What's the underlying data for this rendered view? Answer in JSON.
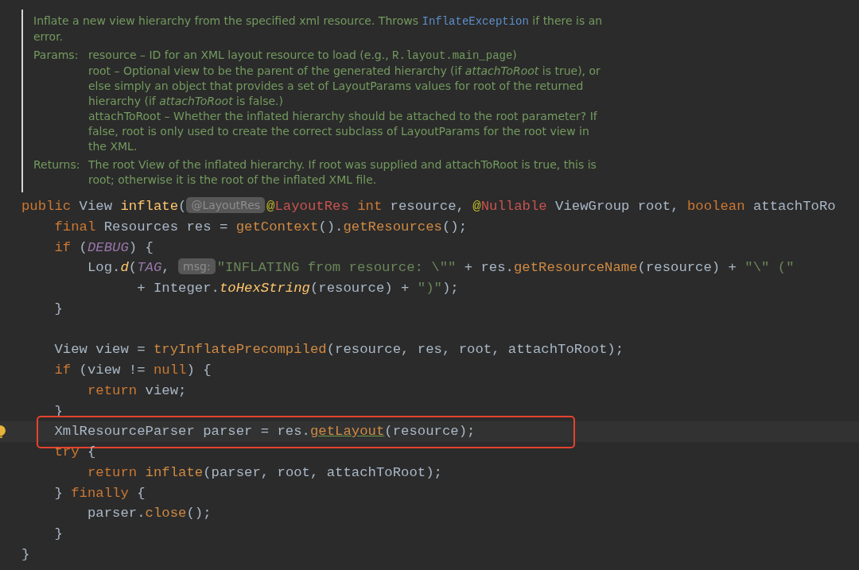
{
  "doc": {
    "description": [
      {
        "kind": "text",
        "text": "Inflate a new view hierarchy from the specified xml resource. Throws "
      },
      {
        "kind": "link",
        "text": "InflateException"
      },
      {
        "kind": "text",
        "text": " if there is an error."
      }
    ],
    "params_label": "Params:",
    "params": [
      [
        {
          "kind": "text",
          "text": "resource – ID for an XML layout resource to load (e.g., "
        },
        {
          "kind": "code",
          "text": "R.layout.main_page"
        },
        {
          "kind": "text",
          "text": ")"
        }
      ],
      [
        {
          "kind": "text",
          "text": "root – Optional view to be the parent of the generated hierarchy (if *attachToRoot* is true), or else simply an object that provides a set of LayoutParams values for root of the returned hierarchy (if *attachToRoot* is false.)"
        }
      ],
      [
        {
          "kind": "text",
          "text": "attachToRoot – Whether the inflated hierarchy should be attached to the root parameter? If false, root is only used to create the correct subclass of LayoutParams for the root view in the XML."
        }
      ]
    ],
    "returns_label": "Returns:",
    "returns": [
      {
        "kind": "text",
        "text": "The root View of the inflated hierarchy. If root was supplied and attachToRoot is true, this is root; otherwise it is the root of the inflated XML file."
      }
    ]
  },
  "code_lines": [
    {
      "kind": "code",
      "highlighted": false,
      "segments": [
        {
          "kind": "code",
          "tokens": [
            {
              "kind": "keyword",
              "text": "public"
            },
            {
              "kind": "plain",
              "text": " View "
            },
            {
              "kind": "decl",
              "text": "inflate"
            },
            {
              "kind": "plain",
              "text": "("
            }
          ]
        },
        {
          "kind": "hint",
          "text": "@LayoutRes"
        },
        {
          "kind": "code",
          "tokens": [
            {
              "kind": "at",
              "text": "@"
            },
            {
              "kind": "annotation",
              "text": "LayoutRes"
            },
            {
              "kind": "keyword",
              "text": " int"
            },
            {
              "kind": "plain",
              "text": " resource, "
            },
            {
              "kind": "at",
              "text": "@"
            },
            {
              "kind": "annotation",
              "text": "Nullable"
            },
            {
              "kind": "plain",
              "text": " ViewGroup root, "
            },
            {
              "kind": "keyword",
              "text": "boolean"
            },
            {
              "kind": "plain",
              "text": " attachToRo"
            }
          ]
        }
      ]
    },
    {
      "kind": "code",
      "highlighted": false,
      "segments": [
        {
          "kind": "code",
          "tokens": [
            {
              "kind": "keyword",
              "text": "    final"
            },
            {
              "kind": "plain",
              "text": " Resources res = "
            },
            {
              "kind": "call",
              "text": "getContext"
            },
            {
              "kind": "plain",
              "text": "()."
            },
            {
              "kind": "call",
              "text": "getResources"
            },
            {
              "kind": "plain",
              "text": "();"
            }
          ]
        }
      ]
    },
    {
      "kind": "code",
      "highlighted": false,
      "segments": [
        {
          "kind": "code",
          "tokens": [
            {
              "kind": "keyword",
              "text": "    if"
            },
            {
              "kind": "plain",
              "text": " ("
            },
            {
              "kind": "constant",
              "text": "DEBUG"
            },
            {
              "kind": "plain",
              "text": ") {"
            }
          ]
        }
      ]
    },
    {
      "kind": "code",
      "highlighted": false,
      "segments": [
        {
          "kind": "code",
          "tokens": [
            {
              "kind": "plain",
              "text": "        Log."
            },
            {
              "kind": "static",
              "text": "d"
            },
            {
              "kind": "plain",
              "text": "("
            },
            {
              "kind": "constant",
              "text": "TAG"
            },
            {
              "kind": "plain",
              "text": ", "
            }
          ]
        },
        {
          "kind": "hint",
          "text": "msg:"
        },
        {
          "kind": "code",
          "tokens": [
            {
              "kind": "string",
              "text": "\"INFLATING from resource: \\\"\""
            },
            {
              "kind": "plain",
              "text": " + res."
            },
            {
              "kind": "call",
              "text": "getResourceName"
            },
            {
              "kind": "plain",
              "text": "(resource) + "
            },
            {
              "kind": "string",
              "text": "\"\\\" (\""
            }
          ]
        }
      ]
    },
    {
      "kind": "code",
      "highlighted": false,
      "segments": [
        {
          "kind": "code",
          "tokens": [
            {
              "kind": "plain",
              "text": "              + Integer."
            },
            {
              "kind": "static",
              "text": "toHexString"
            },
            {
              "kind": "plain",
              "text": "(resource) + "
            },
            {
              "kind": "string",
              "text": "\")\""
            },
            {
              "kind": "plain",
              "text": ");"
            }
          ]
        }
      ]
    },
    {
      "kind": "code",
      "highlighted": false,
      "segments": [
        {
          "kind": "code",
          "tokens": [
            {
              "kind": "plain",
              "text": "    }"
            }
          ]
        }
      ]
    },
    {
      "kind": "blank"
    },
    {
      "kind": "code",
      "highlighted": false,
      "segments": [
        {
          "kind": "code",
          "tokens": [
            {
              "kind": "plain",
              "text": "    View view = "
            },
            {
              "kind": "call",
              "text": "tryInflatePrecompiled"
            },
            {
              "kind": "plain",
              "text": "(resource, res, root, attachToRoot);"
            }
          ]
        }
      ]
    },
    {
      "kind": "code",
      "highlighted": false,
      "segments": [
        {
          "kind": "code",
          "tokens": [
            {
              "kind": "keyword",
              "text": "    if"
            },
            {
              "kind": "plain",
              "text": " (view != "
            },
            {
              "kind": "keyword",
              "text": "null"
            },
            {
              "kind": "plain",
              "text": ") {"
            }
          ]
        }
      ]
    },
    {
      "kind": "code",
      "highlighted": false,
      "segments": [
        {
          "kind": "code",
          "tokens": [
            {
              "kind": "keyword",
              "text": "        return"
            },
            {
              "kind": "plain",
              "text": " view;"
            }
          ]
        }
      ]
    },
    {
      "kind": "code",
      "highlighted": false,
      "segments": [
        {
          "kind": "code",
          "tokens": [
            {
              "kind": "plain",
              "text": "    }"
            }
          ]
        }
      ]
    },
    {
      "kind": "code",
      "highlighted": true,
      "segments": [
        {
          "kind": "code",
          "tokens": [
            {
              "kind": "plain",
              "text": "    XmlResourceParser parser = res."
            },
            {
              "kind": "call_underlined",
              "text": "getLayout"
            },
            {
              "kind": "plain",
              "text": "(resource);"
            }
          ]
        }
      ]
    },
    {
      "kind": "code",
      "highlighted": false,
      "segments": [
        {
          "kind": "code",
          "tokens": [
            {
              "kind": "keyword",
              "text": "    try"
            },
            {
              "kind": "plain",
              "text": " {"
            }
          ]
        }
      ]
    },
    {
      "kind": "code",
      "highlighted": false,
      "segments": [
        {
          "kind": "code",
          "tokens": [
            {
              "kind": "keyword",
              "text": "        return"
            },
            {
              "kind": "call",
              "text": " inflate"
            },
            {
              "kind": "plain",
              "text": "(parser, root, attachToRoot);"
            }
          ]
        }
      ]
    },
    {
      "kind": "code",
      "highlighted": false,
      "segments": [
        {
          "kind": "code",
          "tokens": [
            {
              "kind": "plain",
              "text": "    } "
            },
            {
              "kind": "keyword",
              "text": "finally"
            },
            {
              "kind": "plain",
              "text": " {"
            }
          ]
        }
      ]
    },
    {
      "kind": "code",
      "highlighted": false,
      "segments": [
        {
          "kind": "code",
          "tokens": [
            {
              "kind": "plain",
              "text": "        parser."
            },
            {
              "kind": "call",
              "text": "close"
            },
            {
              "kind": "plain",
              "text": "();"
            }
          ]
        }
      ]
    },
    {
      "kind": "code",
      "highlighted": false,
      "segments": [
        {
          "kind": "code",
          "tokens": [
            {
              "kind": "plain",
              "text": "    }"
            }
          ]
        }
      ]
    },
    {
      "kind": "code",
      "highlighted": false,
      "segments": [
        {
          "kind": "code",
          "tokens": [
            {
              "kind": "plain",
              "text": "}"
            }
          ]
        }
      ]
    }
  ]
}
